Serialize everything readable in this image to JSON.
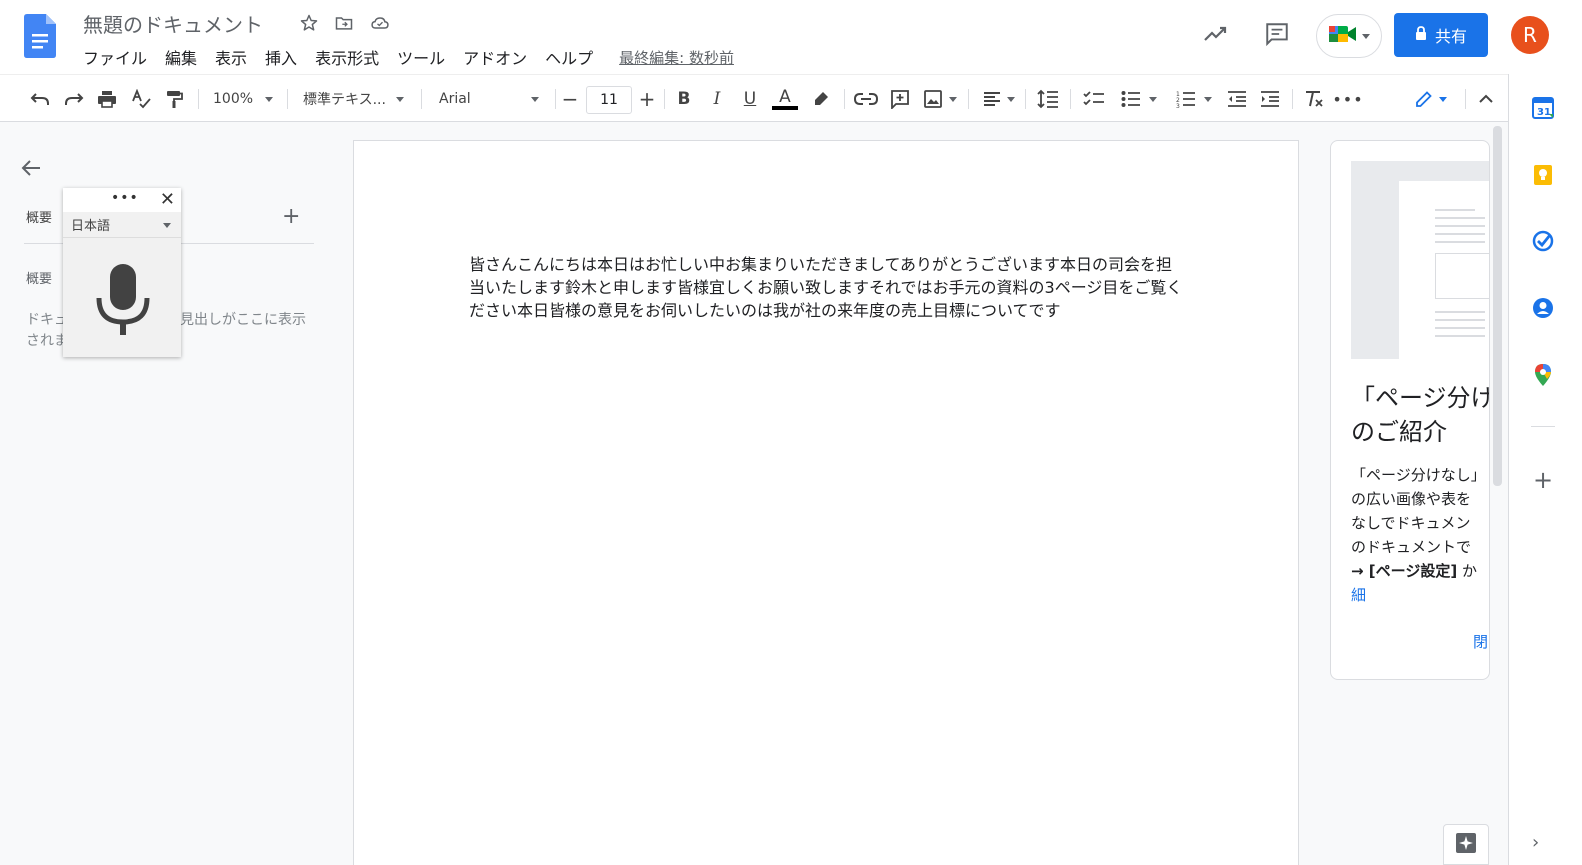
{
  "header": {
    "doc_title": "無題のドキュメント",
    "menu": [
      "ファイル",
      "編集",
      "表示",
      "挿入",
      "表示形式",
      "ツール",
      "アドオン",
      "ヘルプ"
    ],
    "last_edit": "最終編集: 数秒前",
    "share_label": "共有",
    "avatar_letter": "R"
  },
  "toolbar": {
    "zoom": "100%",
    "style": "標準テキス...",
    "font": "Arial",
    "font_size": "11"
  },
  "outline": {
    "heading": "概要",
    "heading2": "概要",
    "empty_text": "ドキュメントに追加した見出しがここに表示されます"
  },
  "voice": {
    "dots": "•••",
    "close": "✕",
    "language": "日本語"
  },
  "document": {
    "body": "皆さんこんにちは本日はお忙しい中お集まりいただきましてありがとうございます本日の司会を担当いたします鈴木と申します皆様宜しくお願い致しますそれではお手元の資料の3ページ目をご覧ください本日皆様の意見をお伺いしたいのは我が社の来年度の売上目標についてです"
  },
  "card": {
    "title_line1": "「ページ分け",
    "title_line2": "のご紹介",
    "body_line1": "「ページ分けなし」",
    "body_line2": "の広い画像や表を",
    "body_line3": "なしでドキュメン",
    "body_line4": "のドキュメントで",
    "body_line5_bold": "→ [ページ設定]",
    "body_line5_rest": " か",
    "link_text": "細",
    "close_text": "閉"
  },
  "colors": {
    "accent": "#1a73e8",
    "avatar": "#e8501c"
  }
}
